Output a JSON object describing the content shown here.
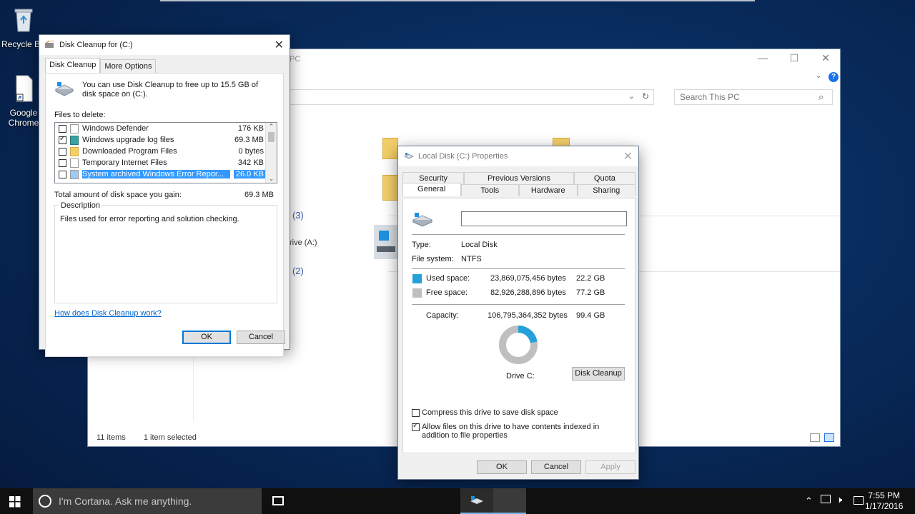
{
  "desktop": {
    "icons": [
      {
        "label": "Recycle Bin",
        "icon": "recycle-bin-icon"
      },
      {
        "label": "Google Chrome",
        "icon": "chrome-shortcut-icon"
      }
    ]
  },
  "explorer": {
    "title_fragment": "PC",
    "search_placeholder": "Search This PC",
    "section_counts": [
      "(3)",
      "(2)"
    ],
    "drive_fragment": "rive (A:)",
    "status": {
      "items": "11 items",
      "selected": "1 item selected"
    }
  },
  "disk_cleanup": {
    "title": "Disk Cleanup for  (C:)",
    "tabs": [
      "Disk Cleanup",
      "More Options"
    ],
    "intro": "You can use Disk Cleanup to free up to 15.5 GB of disk space on  (C:).",
    "files_label": "Files to delete:",
    "files": [
      {
        "name": "Windows Defender",
        "size": "176 KB",
        "checked": false
      },
      {
        "name": "Windows upgrade log files",
        "size": "69.3 MB",
        "checked": true
      },
      {
        "name": "Downloaded Program Files",
        "size": "0 bytes",
        "checked": false
      },
      {
        "name": "Temporary Internet Files",
        "size": "342 KB",
        "checked": false
      },
      {
        "name": "System archived Windows Error Repor...",
        "size": "26.0 KB",
        "checked": false,
        "selected": true
      }
    ],
    "total_label": "Total amount of disk space you gain:",
    "total_value": "69.3 MB",
    "description_label": "Description",
    "description_text": "Files used for error reporting and solution checking.",
    "help_link": "How does Disk Cleanup work?",
    "ok": "OK",
    "cancel": "Cancel"
  },
  "properties": {
    "title": "Local Disk (C:) Properties",
    "tabs_row1": [
      "Security",
      "Previous Versions",
      "Quota"
    ],
    "tabs_row2": [
      "General",
      "Tools",
      "Hardware",
      "Sharing"
    ],
    "name_value": "",
    "type_label": "Type:",
    "type_value": "Local Disk",
    "fs_label": "File system:",
    "fs_value": "NTFS",
    "used_label": "Used space:",
    "used_bytes": "23,869,075,456 bytes",
    "used_gb": "22.2 GB",
    "free_label": "Free space:",
    "free_bytes": "82,926,288,896 bytes",
    "free_gb": "77.2 GB",
    "capacity_label": "Capacity:",
    "capacity_bytes": "106,795,364,352 bytes",
    "capacity_gb": "99.4 GB",
    "used_fraction": 0.2235,
    "used_color": "#26a0da",
    "free_color": "#bfbfbf",
    "drive_label": "Drive C:",
    "disk_cleanup_button": "Disk Cleanup",
    "compress_label": "Compress this drive to save disk space",
    "compress_checked": false,
    "index_label": "Allow files on this drive to have contents indexed in addition to file properties",
    "index_checked": true,
    "ok": "OK",
    "cancel": "Cancel",
    "apply": "Apply"
  },
  "taskbar": {
    "cortana_placeholder": "I'm Cortana. Ask me anything.",
    "time": "7:55 PM",
    "date": "1/17/2016"
  }
}
